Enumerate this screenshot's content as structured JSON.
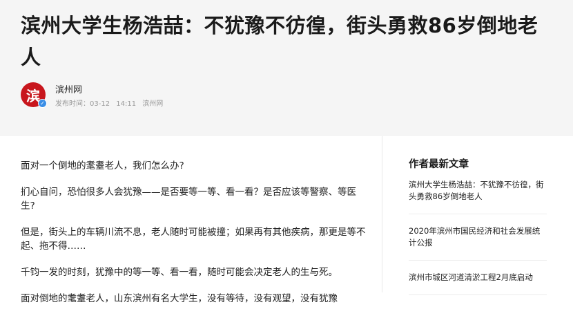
{
  "article": {
    "title": "滨州大学生杨浩喆：不犹豫不彷徨，街头勇救86岁倒地老人",
    "author": {
      "name": "滨州网",
      "avatar_glyph": "滨",
      "publish_label": "发布时间：",
      "date": "03-12",
      "time": "14:11",
      "source": "滨州网"
    },
    "paragraphs": [
      "面对一个倒地的耄耋老人，我们怎么办?",
      "扪心自问，恐怕很多人会犹豫——是否要等一等、看一看？是否应该等警察、等医生?",
      "但是，街头上的车辆川流不息，老人随时可能被撞；如果再有其他疾病，那更是等不起、拖不得……",
      "千钧一发的时刻，犹豫中的等一等、看一看，随时可能会决定老人的生与死。",
      "面对倒地的耄耋老人，山东滨州有名大学生，没有等待，没有观望，没有犹豫"
    ]
  },
  "sidebar": {
    "title": "作者最新文章",
    "items": [
      "滨州大学生杨浩喆：不犹豫不彷徨，街头勇救86岁倒地老人",
      "2020年滨州市国民经济和社会发展统计公报",
      "滨州市城区河道清淤工程2月底启动"
    ]
  },
  "colors": {
    "avatar_bg": "#c8161d",
    "verify_badge": "#3a8ee6",
    "header_bg": "#f5f5f5"
  }
}
